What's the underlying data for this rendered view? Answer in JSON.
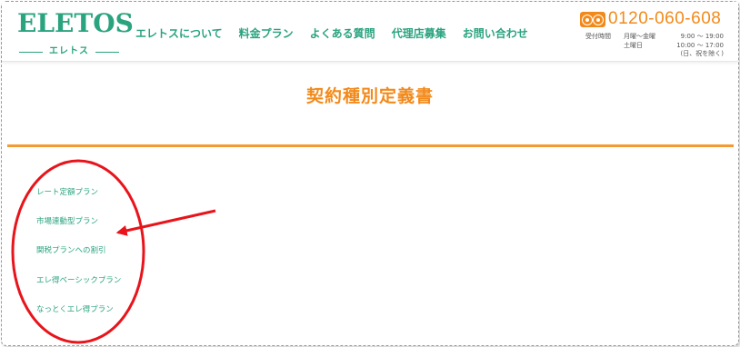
{
  "brand": {
    "logo_text": "ELETOS",
    "logo_sub": "エレトス"
  },
  "nav": {
    "items": [
      {
        "label": "エレトスについて"
      },
      {
        "label": "料金プラン"
      },
      {
        "label": "よくある質問"
      },
      {
        "label": "代理店募集"
      },
      {
        "label": "お問い合わせ"
      }
    ]
  },
  "contact": {
    "icon": "free-dial-icon",
    "phone": "0120-060-608",
    "hours_label": "受付時間",
    "weekdays": "月曜〜金曜",
    "saturday": "土曜日",
    "weekday_hours": "9:00 〜 19:00",
    "saturday_hours": "10:00 〜 17:00",
    "holiday_note": "(日、祝を除く)"
  },
  "page": {
    "title": "契約種別定義書"
  },
  "links": [
    {
      "label": "レート定額プラン"
    },
    {
      "label": "市場連動型プラン"
    },
    {
      "label": "関税プランへの割引"
    },
    {
      "label": "エレ得ベーシックプラン"
    },
    {
      "label": "なっとくエレ得プラン"
    }
  ],
  "annotation": {
    "ellipse_color": "#e8141b",
    "arrow_color": "#e8141b"
  },
  "colors": {
    "brand_green": "#2aa37f",
    "accent_orange": "#f28a1b"
  }
}
